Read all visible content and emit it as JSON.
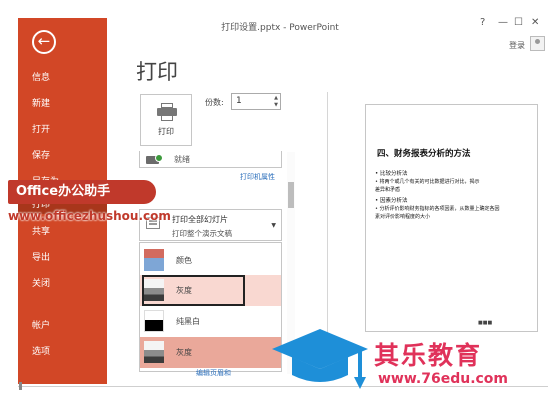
{
  "window": {
    "title": "打印设置.pptx - PowerPoint",
    "help": "?",
    "minimize": "—",
    "maximize": "☐",
    "close": "✕",
    "signin": "登录"
  },
  "sidebar": {
    "back": "←",
    "items": [
      {
        "label": "信息"
      },
      {
        "label": "新建"
      },
      {
        "label": "打开"
      },
      {
        "label": "保存"
      },
      {
        "label": "另存为"
      },
      {
        "label": "打印"
      },
      {
        "label": "共享"
      },
      {
        "label": "导出"
      },
      {
        "label": "关闭"
      },
      {
        "label": "帐户"
      },
      {
        "label": "选项"
      }
    ]
  },
  "print": {
    "title": "打印",
    "button_label": "打印",
    "copies_label": "份数:",
    "copies_value": "1",
    "printer_status": "就绪",
    "printer_properties": "打印机属性",
    "range_title": "打印全部幻灯片",
    "range_sub": "打印整个演示文稿",
    "color_options": [
      {
        "label": "颜色"
      },
      {
        "label": "灰度"
      },
      {
        "label": "纯黑白"
      },
      {
        "label": "灰度"
      }
    ],
    "edit_footer": "编辑页眉和"
  },
  "preview": {
    "title": "四、财务报表分析的方法",
    "lines": [
      "• 比较分析法",
      "• 将两个或几个有关的可比数据进行对比，揭示",
      "  差异和矛盾",
      "• 因素分析法",
      "• 分析评价影响财务指标的各项因素，从数量上确定各因",
      "  素对评价影响程度的大小"
    ],
    "page_nav": "■■■"
  },
  "watermark": {
    "brand_ribbon": "Office办公助手",
    "brand_url": "www.officezhushou.com",
    "edu_name": "其乐教育",
    "edu_url": "www.76edu.com"
  }
}
